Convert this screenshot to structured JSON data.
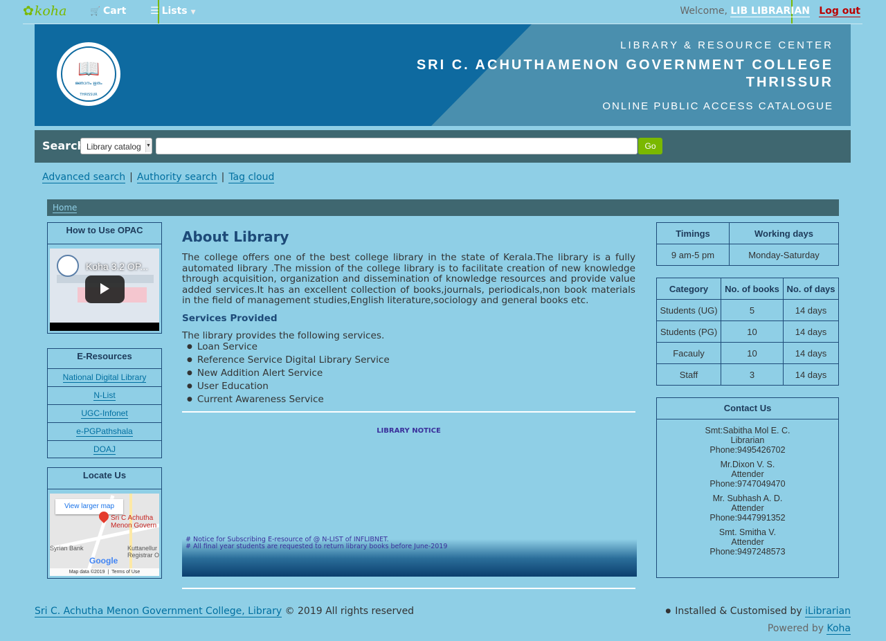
{
  "topnav": {
    "logo": "koha",
    "cart": "Cart",
    "lists": "Lists",
    "welcome": "Welcome,",
    "user": "LIB LIBRARIAN",
    "logout": "Log out"
  },
  "banner": {
    "line1": "LIBRARY & RESOURCE CENTER",
    "line2": "SRI C. ACHUTHAMENON GOVERNMENT COLLEGE",
    "line3": "THRISSUR",
    "line4": "ONLINE PUBLIC ACCESS CATALOGUE",
    "seal_motto": "ജ്ഞാനം ഋതം",
    "seal_city": "THRISSUR"
  },
  "search": {
    "label": "Search",
    "scope": "Library catalog",
    "go": "Go",
    "query": ""
  },
  "sublinks": {
    "advanced": "Advanced search",
    "authority": "Authority search",
    "tagcloud": "Tag cloud"
  },
  "breadcrumb": {
    "home": "Home"
  },
  "howto": {
    "title": "How to Use OPAC",
    "video_title": "Koha 3.2 OP..."
  },
  "eresources": {
    "title": "E-Resources",
    "items": [
      "National Digital Library",
      "N-List",
      "UGC-Infonet",
      "e-PGPathshala",
      "DOAJ"
    ]
  },
  "locate": {
    "title": "Locate Us",
    "larger_map": "View larger map",
    "pin_label_1": "Sri C Achutha",
    "pin_label_2": "Menon Govern",
    "place1": "Syrian Bank",
    "place2": "Kuttanellur",
    "place3": "Registrar O",
    "google": "Google",
    "map_data": "Map data ©2019",
    "terms": "Terms of Use"
  },
  "about": {
    "title": "About Library",
    "text": "The college offers one of the best college library in the state of Kerala.The library is a fully automated library .The mission of the college library is to facilitate creation of new knowledge through acquisition, organization and dissemination of knowledge resources and provide value added services.It has an excellent collection of books,journals, periodicals,non book materials in the field of management studies,English literature,sociology and general books etc.",
    "services_title": "Services Provided",
    "services_intro": "The library provides the following services.",
    "services": [
      "Loan Service",
      "Reference Service Digital Library Service",
      "New Addition Alert Service",
      "User Education",
      "Current Awareness Service"
    ]
  },
  "notice": {
    "title": "LIBRARY NOTICE",
    "lines": [
      "# Notice for Subscribing E-resource of @ N-LIST of INFLIBNET.",
      "# All final year students are requested to return library books before June-2019"
    ]
  },
  "timings": {
    "headers": [
      "Timings",
      "Working days"
    ],
    "row": [
      "9 am-5 pm",
      "Monday-Saturday"
    ]
  },
  "category": {
    "headers": [
      "Category",
      "No. of books",
      "No. of days"
    ],
    "rows": [
      [
        "Students (UG)",
        "5",
        "14 days"
      ],
      [
        "Students (PG)",
        "10",
        "14 days"
      ],
      [
        "Facauly",
        "10",
        "14 days"
      ],
      [
        "Staff",
        "3",
        "14 days"
      ]
    ]
  },
  "contact": {
    "title": "Contact Us",
    "people": [
      {
        "name": "Smt:Sabitha Mol E. C.",
        "role": "Librarian",
        "phone": "Phone:9495426702"
      },
      {
        "name": "Mr.Dixon V. S.",
        "role": "Attender",
        "phone": "Phone:9747049470"
      },
      {
        "name": "Mr. Subhash A. D.",
        "role": "Attender",
        "phone": "Phone:9447991352"
      },
      {
        "name": "Smt. Smitha V.",
        "role": "Attender",
        "phone": "Phone:9497248573"
      }
    ]
  },
  "footer": {
    "college_link": "Sri C. Achutha Menon Government College, Library",
    "rights": "© 2019 All rights reserved",
    "installed": "Installed & Customised by",
    "installer": "iLibrarian",
    "powered": "Powered by",
    "koha": "Koha"
  },
  "colors": {
    "page_bg": "#8fcfe6",
    "bar_bg": "#3f6770",
    "banner_bg": "#0e6aa0",
    "accent_green": "#7ab800",
    "link": "#006fa0",
    "logout": "#bb0000"
  }
}
